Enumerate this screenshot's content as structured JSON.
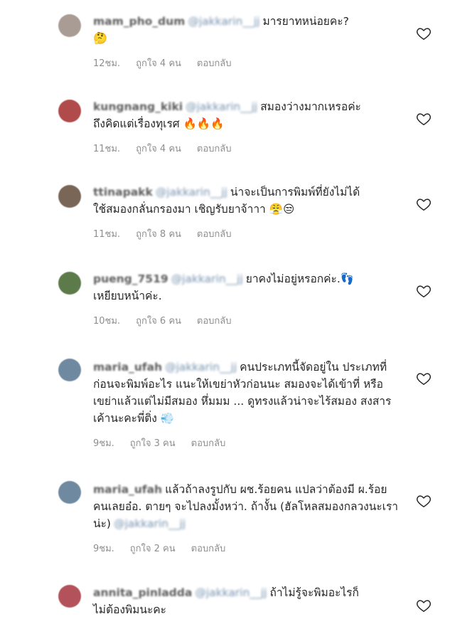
{
  "comments": [
    {
      "username": "mam_pho_dum",
      "mention": "@jakkarin__jj",
      "text_line1": "มารยาทหน่อยคะ?",
      "text_rest": "🤔",
      "time": "12ชม.",
      "likes": "ถูกใจ 4 คน",
      "reply": "ตอบกลับ",
      "avatar_color": "#a99c95"
    },
    {
      "username": "kungnang_kiki",
      "mention": "@jakkarin__jj",
      "text_line1": "สมองว่างมากเหรอค่ะ",
      "text_rest": "ถึงคิดแต่เรื่องทุเรศ 🔥🔥🔥",
      "time": "11ชม.",
      "likes": "ถูกใจ 4 คน",
      "reply": "ตอบกลับ",
      "avatar_color": "#b14a4a"
    },
    {
      "username": "ttinapakk",
      "mention": "@jakkarin__jj",
      "text_line1": "น่าจะเป็นการพิมพ์ที่ยังไม่ได้",
      "text_rest": "ใช้สมองกลั่นกรองมา เชิญรับยาจ้าาา 😤😒",
      "time": "11ชม.",
      "likes": "ถูกใจ 8 คน",
      "reply": "ตอบกลับ",
      "avatar_color": "#7a6656"
    },
    {
      "username": "pueng_7519",
      "mention": "@jakkarin__jj",
      "text_line1": "ยาคงไม่อยู่หรอกค่ะ.👣",
      "text_rest": "เหยียบหน้าค่ะ.",
      "time": "10ชม.",
      "likes": "ถูกใจ 6 คน",
      "reply": "ตอบกลับ",
      "avatar_color": "#5c7a4a"
    },
    {
      "username": "maria_ufah",
      "mention": "@jakkarin__jj",
      "text_line1": "คนประเภทนี้จัดอยู่ใน",
      "text_rest": "ประเภทที่ก่อนจะพิมพ์อะไร แนะให้เขย่าหัวก่อนนะ สมองจะได้เข้าที่ หรือเขย่าแล้วแต่ไม่มีสมอง หึ่มมม ... ดูทรงแล้วน่าจะไร้สมอง สงสารเค้านะคะพี่ติ่ง 💨",
      "time": "9ชม.",
      "likes": "ถูกใจ 3 คน",
      "reply": "ตอบกลับ",
      "avatar_color": "#6f8aa0"
    },
    {
      "username": "maria_ufah",
      "mention": "@jakkarin__jj",
      "text_line1": "แล้วถ้าลงรูปกับ ผช.ร้อยคน แปลว่าต้องมี",
      "text_rest": "ผ.ร้อยคนเลยอ๋อ. ตายๆ จะไปลงมั้งหว่า. ถ้างั้น (ฮัลโหลสมองกลวงนะเราน่ะ)",
      "time": "9ชม.",
      "likes": "ถูกใจ 2 คน",
      "reply": "ตอบกลับ",
      "avatar_color": "#6f8aa0"
    },
    {
      "username": "annita_pinladda",
      "mention": "@jakkarin__jj",
      "text_line1": "ถ้าไม่รู้จะพิมอะไรก็",
      "text_rest": "ไม่ต้องพิมนะคะ",
      "time": "",
      "likes": "",
      "reply": "",
      "avatar_color": "#b3525a"
    }
  ]
}
